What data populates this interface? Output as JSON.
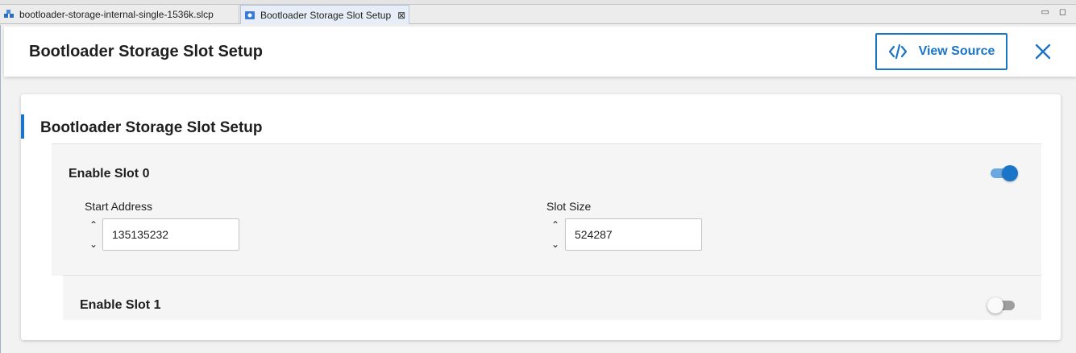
{
  "tabs": [
    {
      "label": "bootloader-storage-internal-single-1536k.slcp",
      "active": false,
      "icon": "project-icon"
    },
    {
      "label": "Bootloader Storage Slot Setup",
      "active": true,
      "icon": "config-icon"
    }
  ],
  "header": {
    "title": "Bootloader Storage Slot Setup",
    "view_source_label": "View Source"
  },
  "card": {
    "title": "Bootloader Storage Slot Setup",
    "slot0": {
      "label": "Enable Slot 0",
      "enabled": true,
      "start_address_label": "Start Address",
      "start_address_value": "135135232",
      "slot_size_label": "Slot Size",
      "slot_size_value": "524287"
    },
    "slot1": {
      "label": "Enable Slot 1",
      "enabled": false
    }
  },
  "colors": {
    "accent": "#1a74c7",
    "toggle_on_track": "#6aa8e0",
    "toggle_off_track": "#9e9e9e"
  }
}
